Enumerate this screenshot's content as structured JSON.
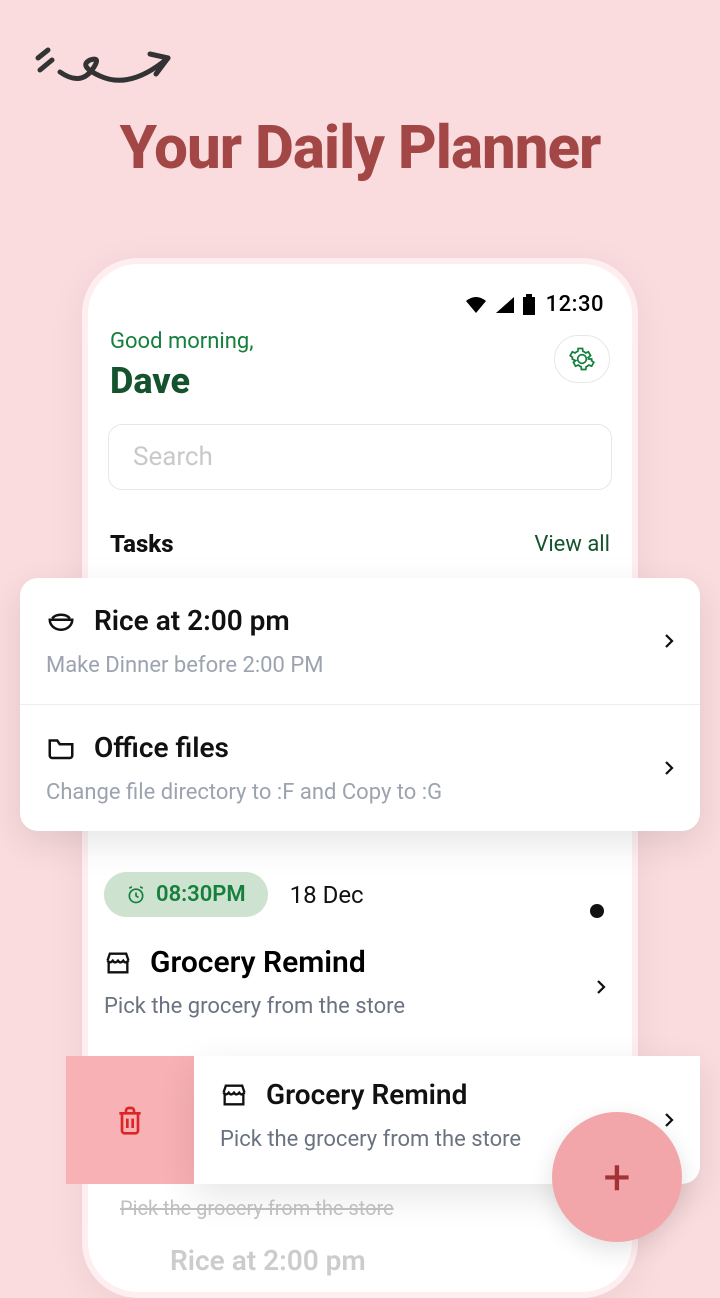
{
  "headline": "Your Daily Planner",
  "statusbar": {
    "time": "12:30"
  },
  "greeting": "Good morning,",
  "username": "Dave",
  "search_placeholder": "Search",
  "tasks": {
    "title": "Tasks",
    "viewall": "View all",
    "items": [
      {
        "title": "Rice at 2:00 pm",
        "sub": "Make Dinner before 2:00 PM",
        "icon": "bowl"
      },
      {
        "title": "Office files",
        "sub": "Change file directory to :F and Copy to :G",
        "icon": "folder"
      }
    ]
  },
  "reminder": {
    "time": "08:30PM",
    "date": "18 Dec",
    "title": "Grocery Remind",
    "sub": "Pick the grocery from the store"
  },
  "swipe": {
    "title": "Grocery Remind",
    "sub": "Pick the grocery from the store"
  },
  "ghost": {
    "sub": "Pick the grocery from the store",
    "title": "Rice at 2:00 pm"
  },
  "fab": "+"
}
